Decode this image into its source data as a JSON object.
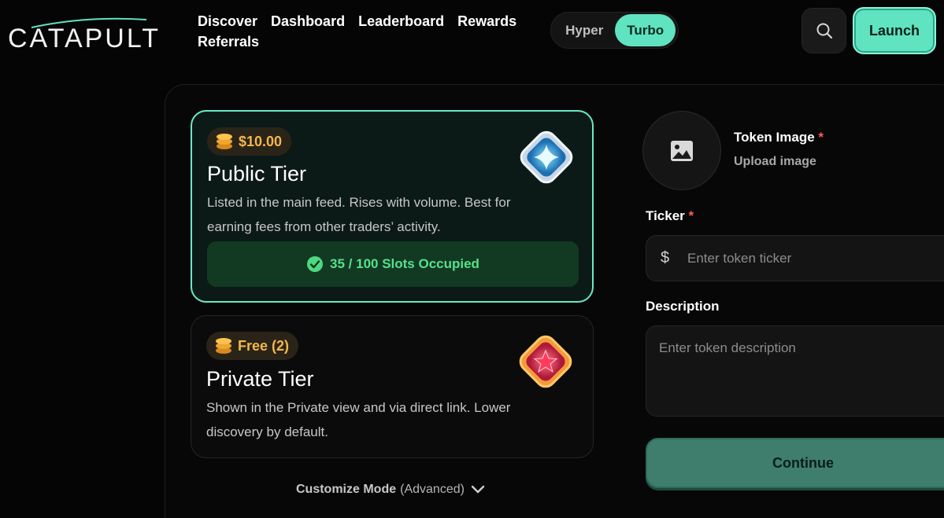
{
  "brand": {
    "name": "CATAPULT",
    "accent": "#5fe3c0"
  },
  "nav": {
    "items": [
      {
        "label": "Discover"
      },
      {
        "label": "Dashboard"
      },
      {
        "label": "Leaderboard"
      },
      {
        "label": "Rewards"
      },
      {
        "label": "Referrals"
      }
    ]
  },
  "mode": {
    "options": [
      "Hyper",
      "Turbo"
    ],
    "selected": "Turbo"
  },
  "header": {
    "search_icon": "search-icon",
    "launch_label": "Launch"
  },
  "tiers": [
    {
      "price": "$10.00",
      "title": "Public Tier",
      "description": "Listed in the main feed. Rises with volume. Best for earning fees from other traders’ activity.",
      "slots": "35 / 100 Slots Occupied",
      "selected": true,
      "icon": "sparkle-diamond-icon"
    },
    {
      "price": "Free (2)",
      "title": "Private Tier",
      "description": "Shown in the Private view and via direct link. Lower discovery by default.",
      "selected": false,
      "icon": "star-diamond-icon"
    }
  ],
  "customize": {
    "label": "Customize Mode",
    "suffix": "(Advanced)"
  },
  "form": {
    "image_title": "Token Image",
    "required_mark": "*",
    "image_sub": "Upload image",
    "ticker_label": "Ticker",
    "ticker_prefix": "$",
    "ticker_placeholder": "Enter token ticker",
    "description_label": "Description",
    "description_placeholder": "Enter token description",
    "continue_label": "Continue"
  }
}
